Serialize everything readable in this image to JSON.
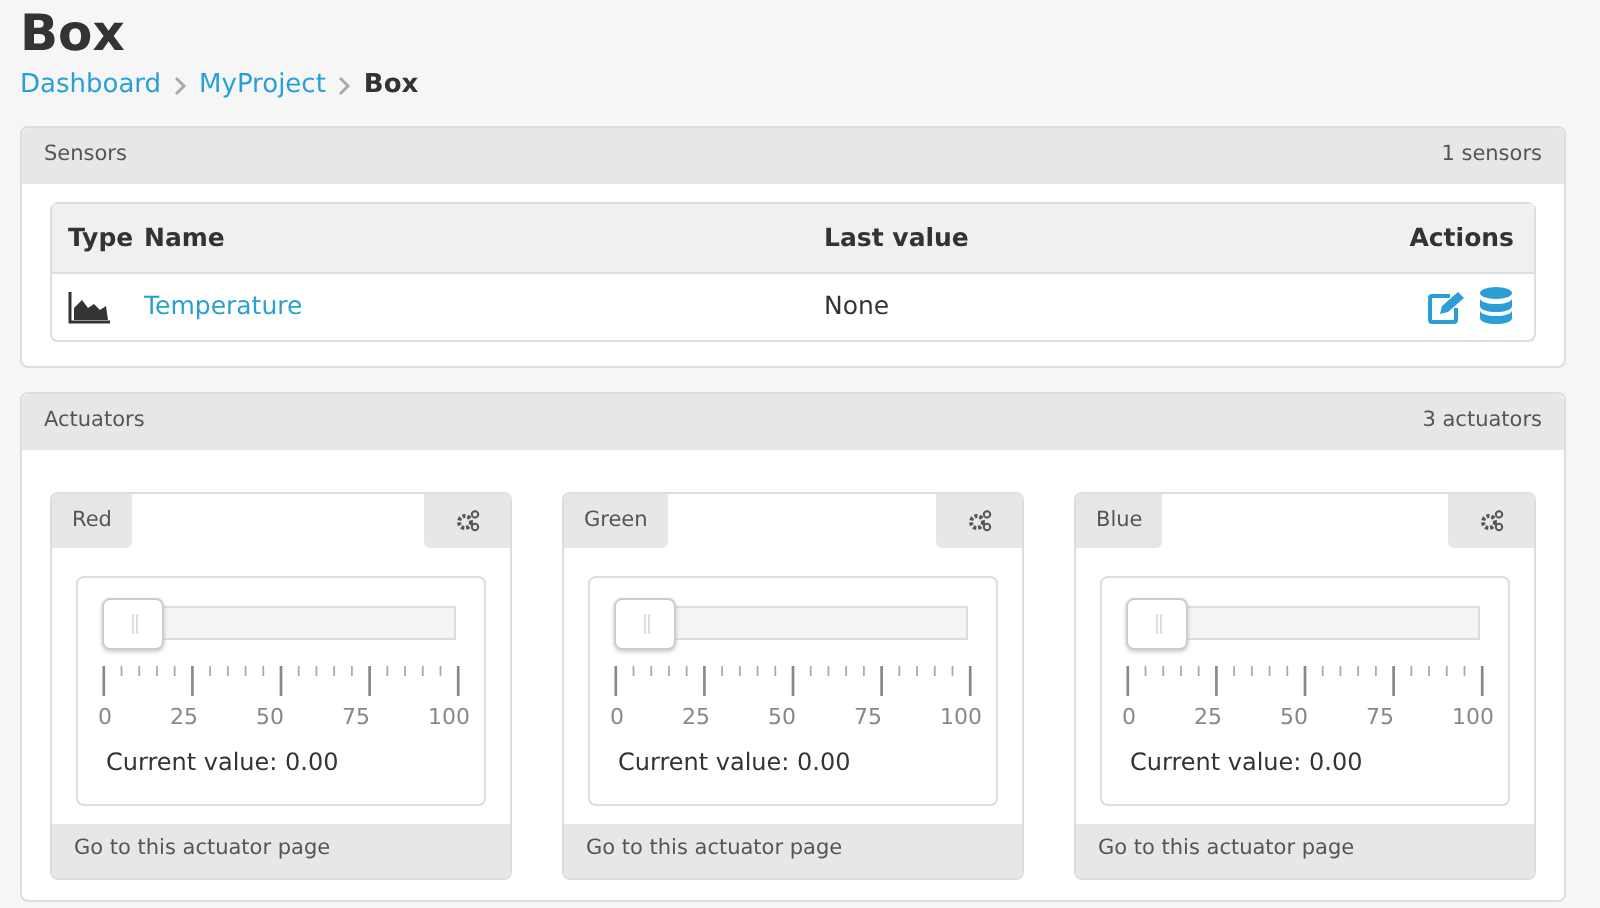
{
  "page_title": "Box",
  "breadcrumb": [
    {
      "label": "Dashboard",
      "current": false
    },
    {
      "label": "MyProject",
      "current": false
    },
    {
      "label": "Box",
      "current": true
    }
  ],
  "sensors": {
    "title": "Sensors",
    "count": "1 sensors",
    "columns": [
      "Type",
      "Name",
      "Last value",
      "Actions"
    ],
    "rows": [
      {
        "name": "Temperature",
        "last_value": "None"
      }
    ]
  },
  "actuators": {
    "title": "Actuators",
    "count": "3 actuators",
    "items": [
      {
        "name": "Red",
        "level": 0,
        "ticks": [
          "0",
          "25",
          "50",
          "75",
          "100"
        ],
        "reading": "Current value: 0.00",
        "footer": "Go to this actuator page"
      },
      {
        "name": "Green",
        "level": 0,
        "ticks": [
          "0",
          "25",
          "50",
          "75",
          "100"
        ],
        "reading": "Current value: 0.00",
        "footer": "Go to this actuator page"
      },
      {
        "name": "Blue",
        "level": 0,
        "ticks": [
          "0",
          "25",
          "50",
          "75",
          "100"
        ],
        "reading": "Current value: 0.00",
        "footer": "Go to this actuator page"
      }
    ]
  }
}
